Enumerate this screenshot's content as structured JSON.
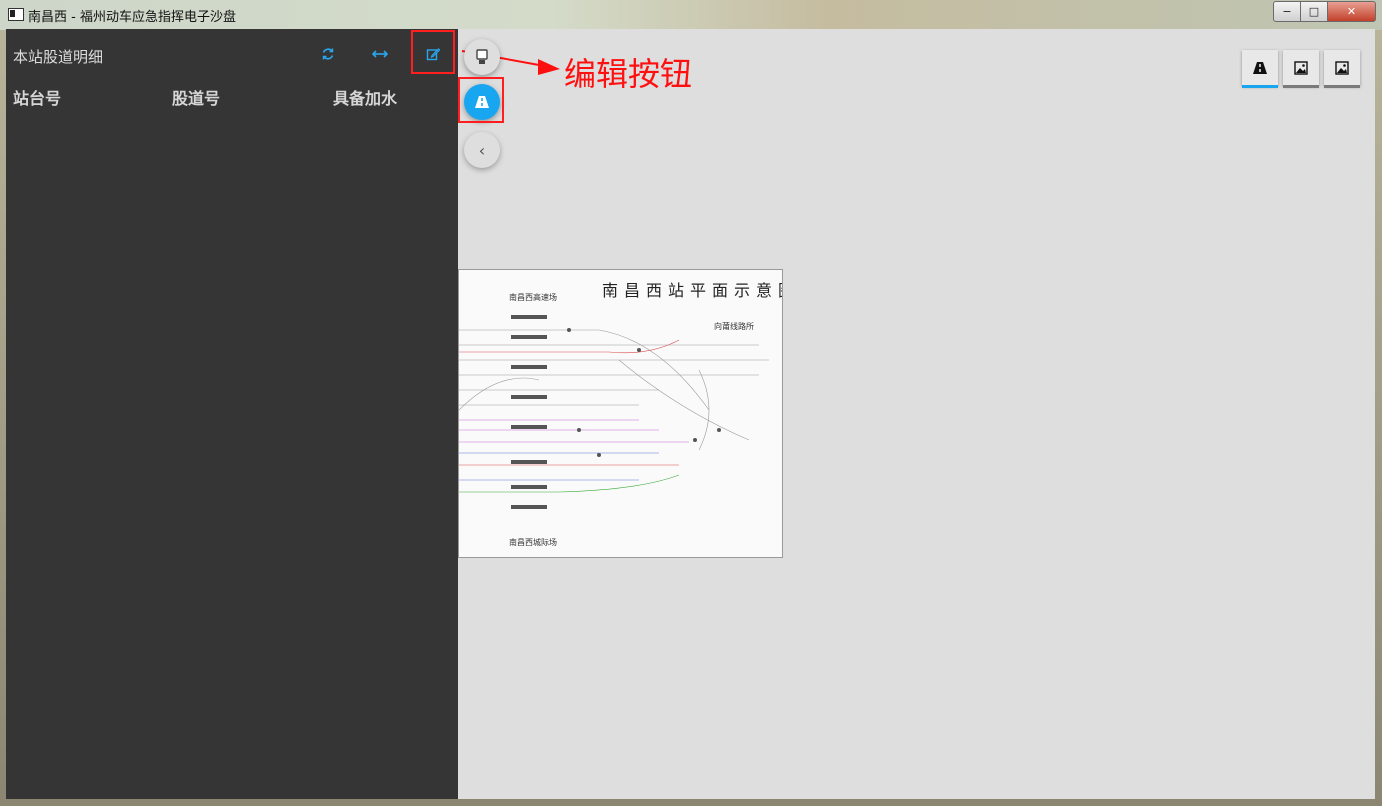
{
  "window": {
    "title": "南昌西 - 福州动车应急指挥电子沙盘",
    "minimize": "−",
    "maximize": "□",
    "close": "✕"
  },
  "panel": {
    "title": "本站股道明细",
    "columns": [
      "站台号",
      "股道号",
      "具备加水"
    ],
    "buttons": {
      "refresh_icon": "refresh-icon",
      "expand_icon": "arrows-horizontal-icon",
      "edit_icon": "edit-icon"
    }
  },
  "annotation": {
    "text": "编辑按钮",
    "color": "#ff1010"
  },
  "floating": {
    "back_glyph": "‹"
  },
  "map": {
    "title": "南昌西站平面示意图",
    "label_top": "南昌西高速场",
    "label_right": "向莆线路所",
    "label_bottom": "南昌西城际场"
  },
  "colors": {
    "accent": "#1aa6ef",
    "panel_bg": "#353535",
    "highlight": "#ff1f1f"
  }
}
